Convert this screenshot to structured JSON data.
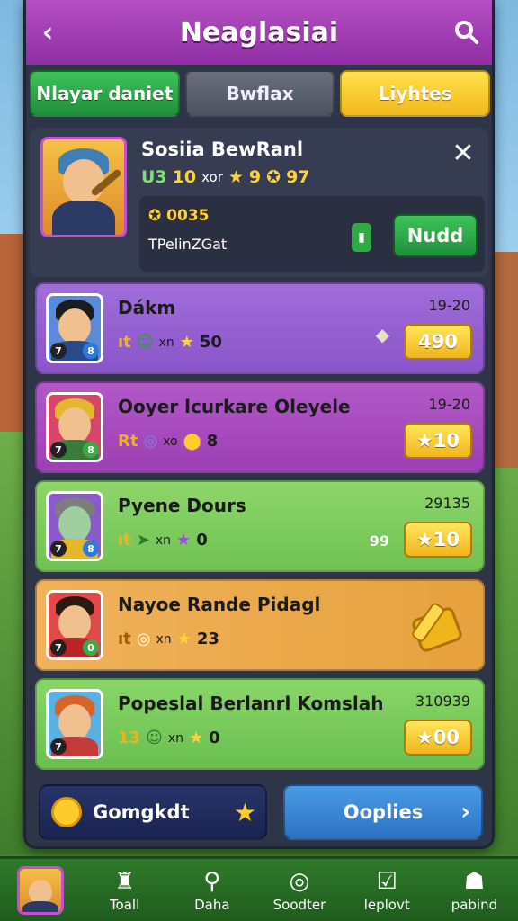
{
  "header": {
    "title": "Neaglasiai",
    "back_icon": "back-arrow-icon",
    "search_icon": "search-icon"
  },
  "tabs": [
    {
      "label": "Nlayar daniet",
      "style": "green"
    },
    {
      "label": "Bwflax",
      "style": "gray"
    },
    {
      "label": "Liyhtes",
      "style": "yellow"
    }
  ],
  "profile": {
    "name": "Sosiia BewRanl",
    "level": "U3",
    "level_num": "10",
    "xp_label": "xor",
    "stars": "9",
    "score": "97",
    "coins": "0035",
    "subtitle": "TPelinZGat",
    "action_label": "Nudd"
  },
  "cards": [
    {
      "title": "Dákm",
      "date": "19-20",
      "level": "7",
      "meta_prefix": "ıt",
      "xn": "xn",
      "meta_value": "50",
      "reward": "490",
      "color": "purple"
    },
    {
      "title": "Ooyer lcurkare Oleyele",
      "date": "19-20",
      "level": "7",
      "meta_prefix": "Rt",
      "xn": "xo",
      "meta_value": "8",
      "reward": "10",
      "color": "magenta"
    },
    {
      "title": "Pyene Dours",
      "date": "29135",
      "level": "7",
      "meta_prefix": "ıt",
      "xn": "xn",
      "meta_value": "0",
      "reward": "10",
      "side_text": "99",
      "color": "green"
    },
    {
      "title": "Nayoe Rande Pidagl",
      "date": "",
      "level": "7",
      "meta_prefix": "ıt",
      "xn": "xn",
      "meta_value": "23",
      "reward": "",
      "color": "orange"
    },
    {
      "title": "Popeslal Berlanrl Komslah",
      "date": "310939",
      "level": "7",
      "meta_prefix": "13",
      "xn": "xn",
      "meta_value": "0",
      "reward": "00",
      "color": "lgreen"
    }
  ],
  "bottom_buttons": {
    "left_label": "Gomgkdt",
    "right_label": "Ooplies"
  },
  "navbar": [
    {
      "label": "Toall",
      "icon": "tower-icon"
    },
    {
      "label": "Daha",
      "icon": "search-icon"
    },
    {
      "label": "Soodter",
      "icon": "target-icon"
    },
    {
      "label": "leplovt",
      "icon": "checkbox-icon"
    },
    {
      "label": "pabind",
      "icon": "robot-icon"
    }
  ]
}
